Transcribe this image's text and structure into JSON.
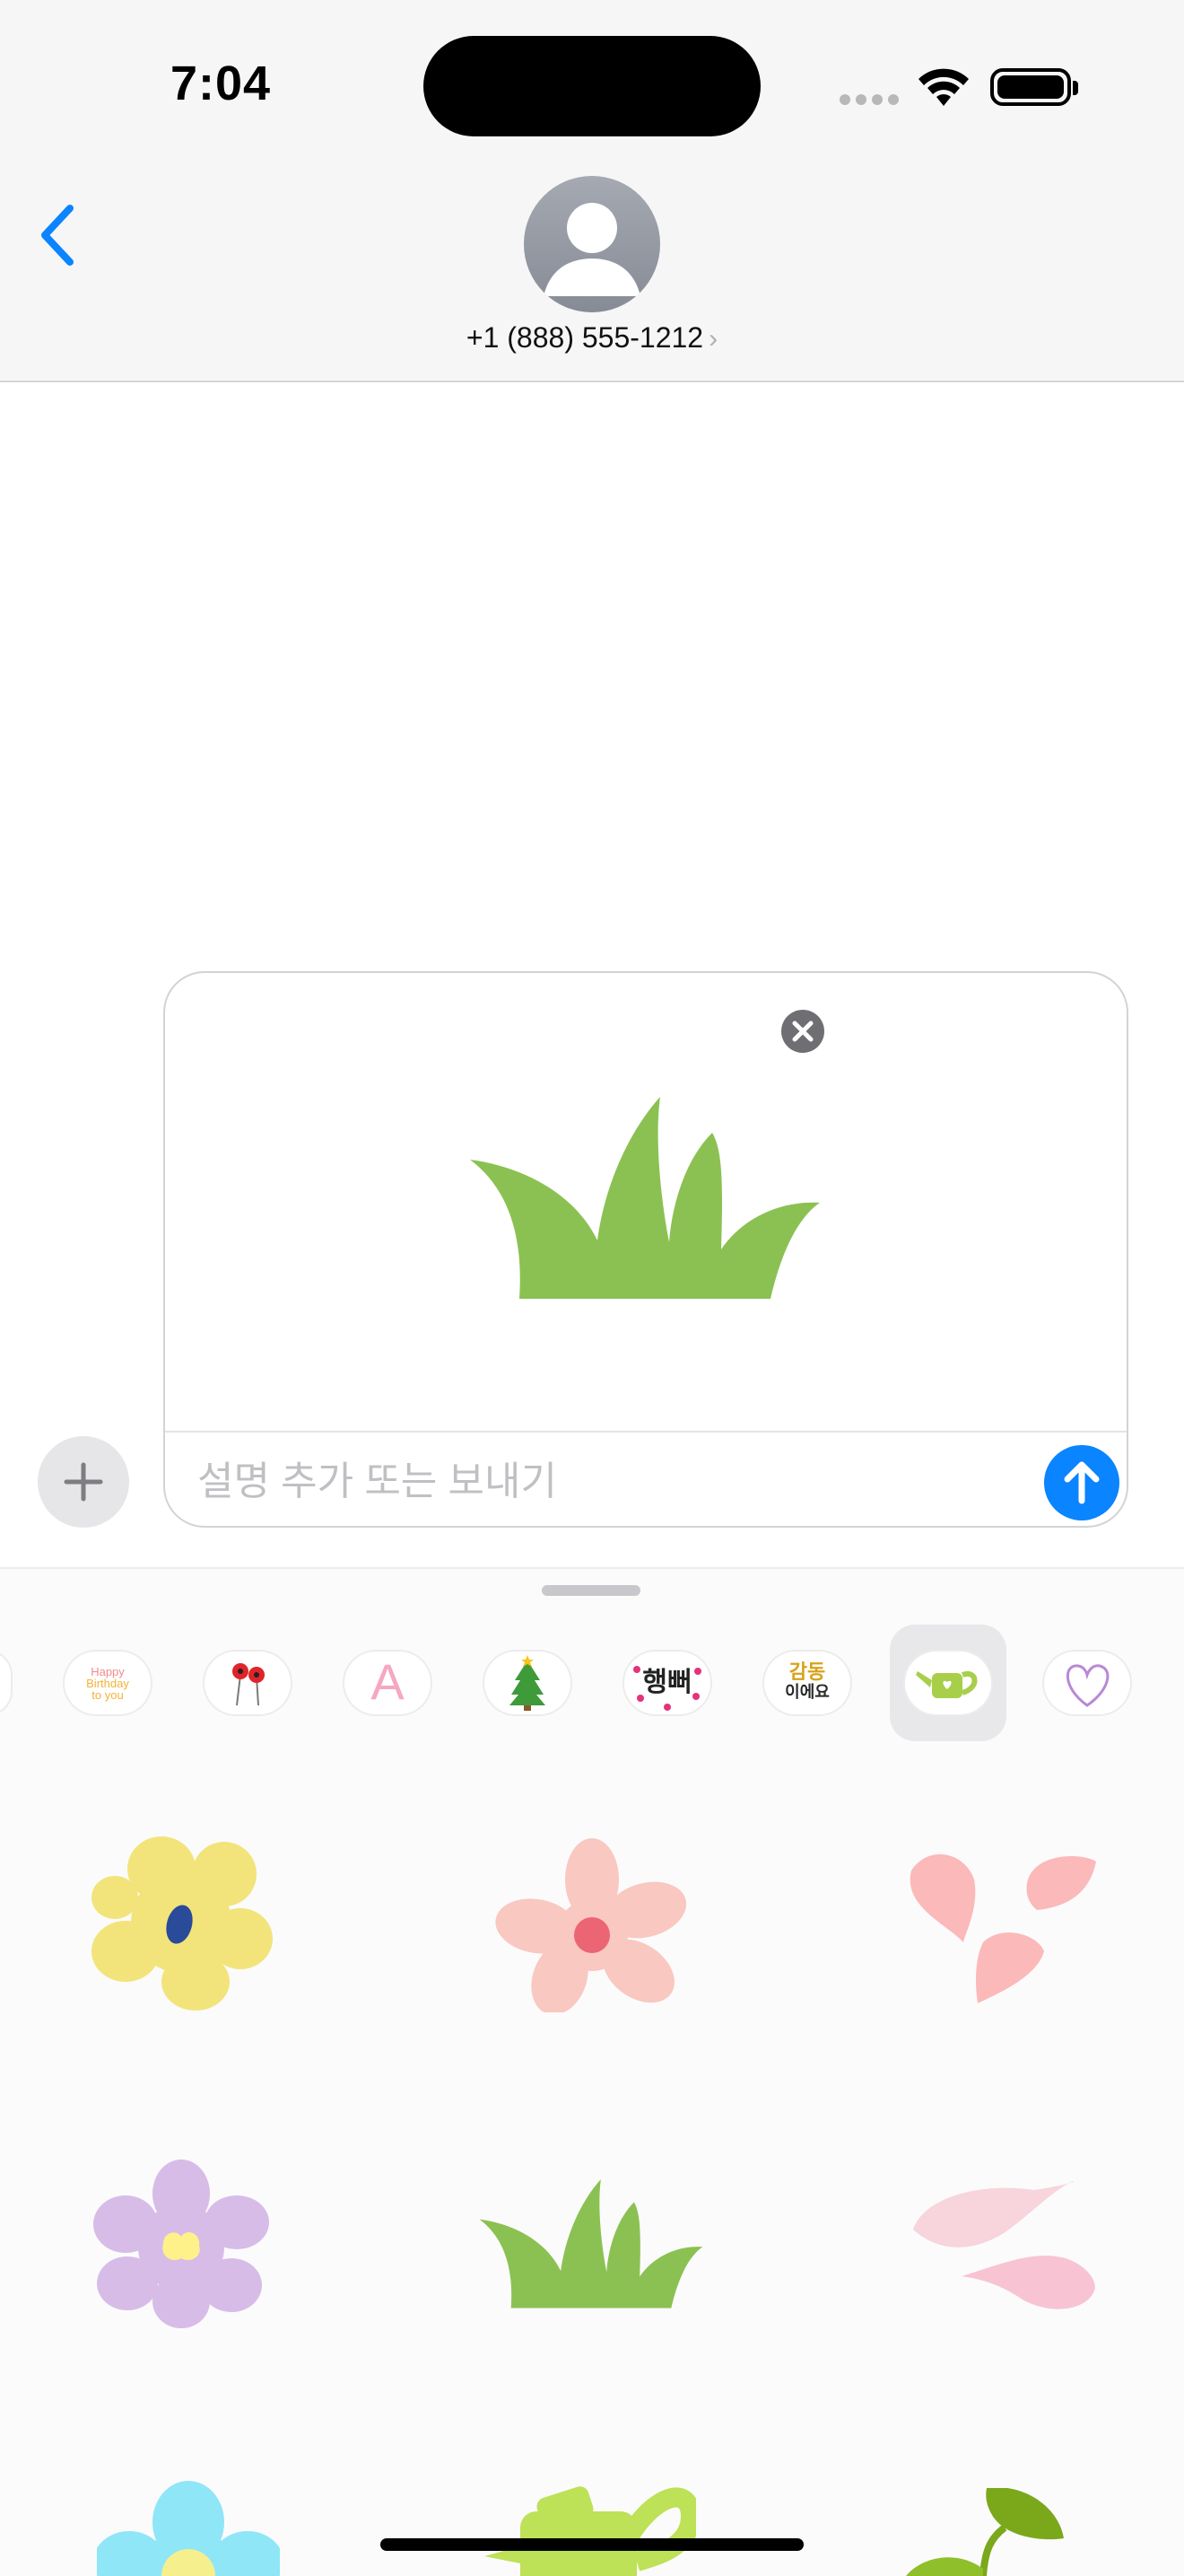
{
  "status_bar": {
    "time": "7:04"
  },
  "header": {
    "contact_label": "+1 (888) 555-1212",
    "contact_chevron": "›"
  },
  "compose": {
    "placeholder": "설명 추가 또는 보내기",
    "attached_sticker": "grass-sticker"
  },
  "drawer": {
    "packs": [
      {
        "name": "birthday-pack",
        "text": [
          "Happy",
          "Birthday",
          "to you"
        ]
      },
      {
        "name": "poppies-pack"
      },
      {
        "name": "letter-a-pack",
        "text": [
          "A"
        ]
      },
      {
        "name": "tree-pack"
      },
      {
        "name": "korean-text-pack-1",
        "text": [
          "행뻐"
        ]
      },
      {
        "name": "korean-text-pack-2",
        "text": [
          "감동",
          "이에요"
        ]
      },
      {
        "name": "watering-can-pack",
        "selected": true
      },
      {
        "name": "heart-pack"
      }
    ],
    "stickers": [
      "yellow-flower-sticker",
      "pink-flower-sticker",
      "pink-petals-sticker",
      "purple-flower-sticker",
      "grass-sticker",
      "pink-leaves-sticker",
      "blue-flower-sticker",
      "watering-can-sticker",
      "green-sprout-sticker"
    ]
  },
  "colors": {
    "accent_blue": "#0a84ff",
    "grass_green": "#8bc152"
  }
}
